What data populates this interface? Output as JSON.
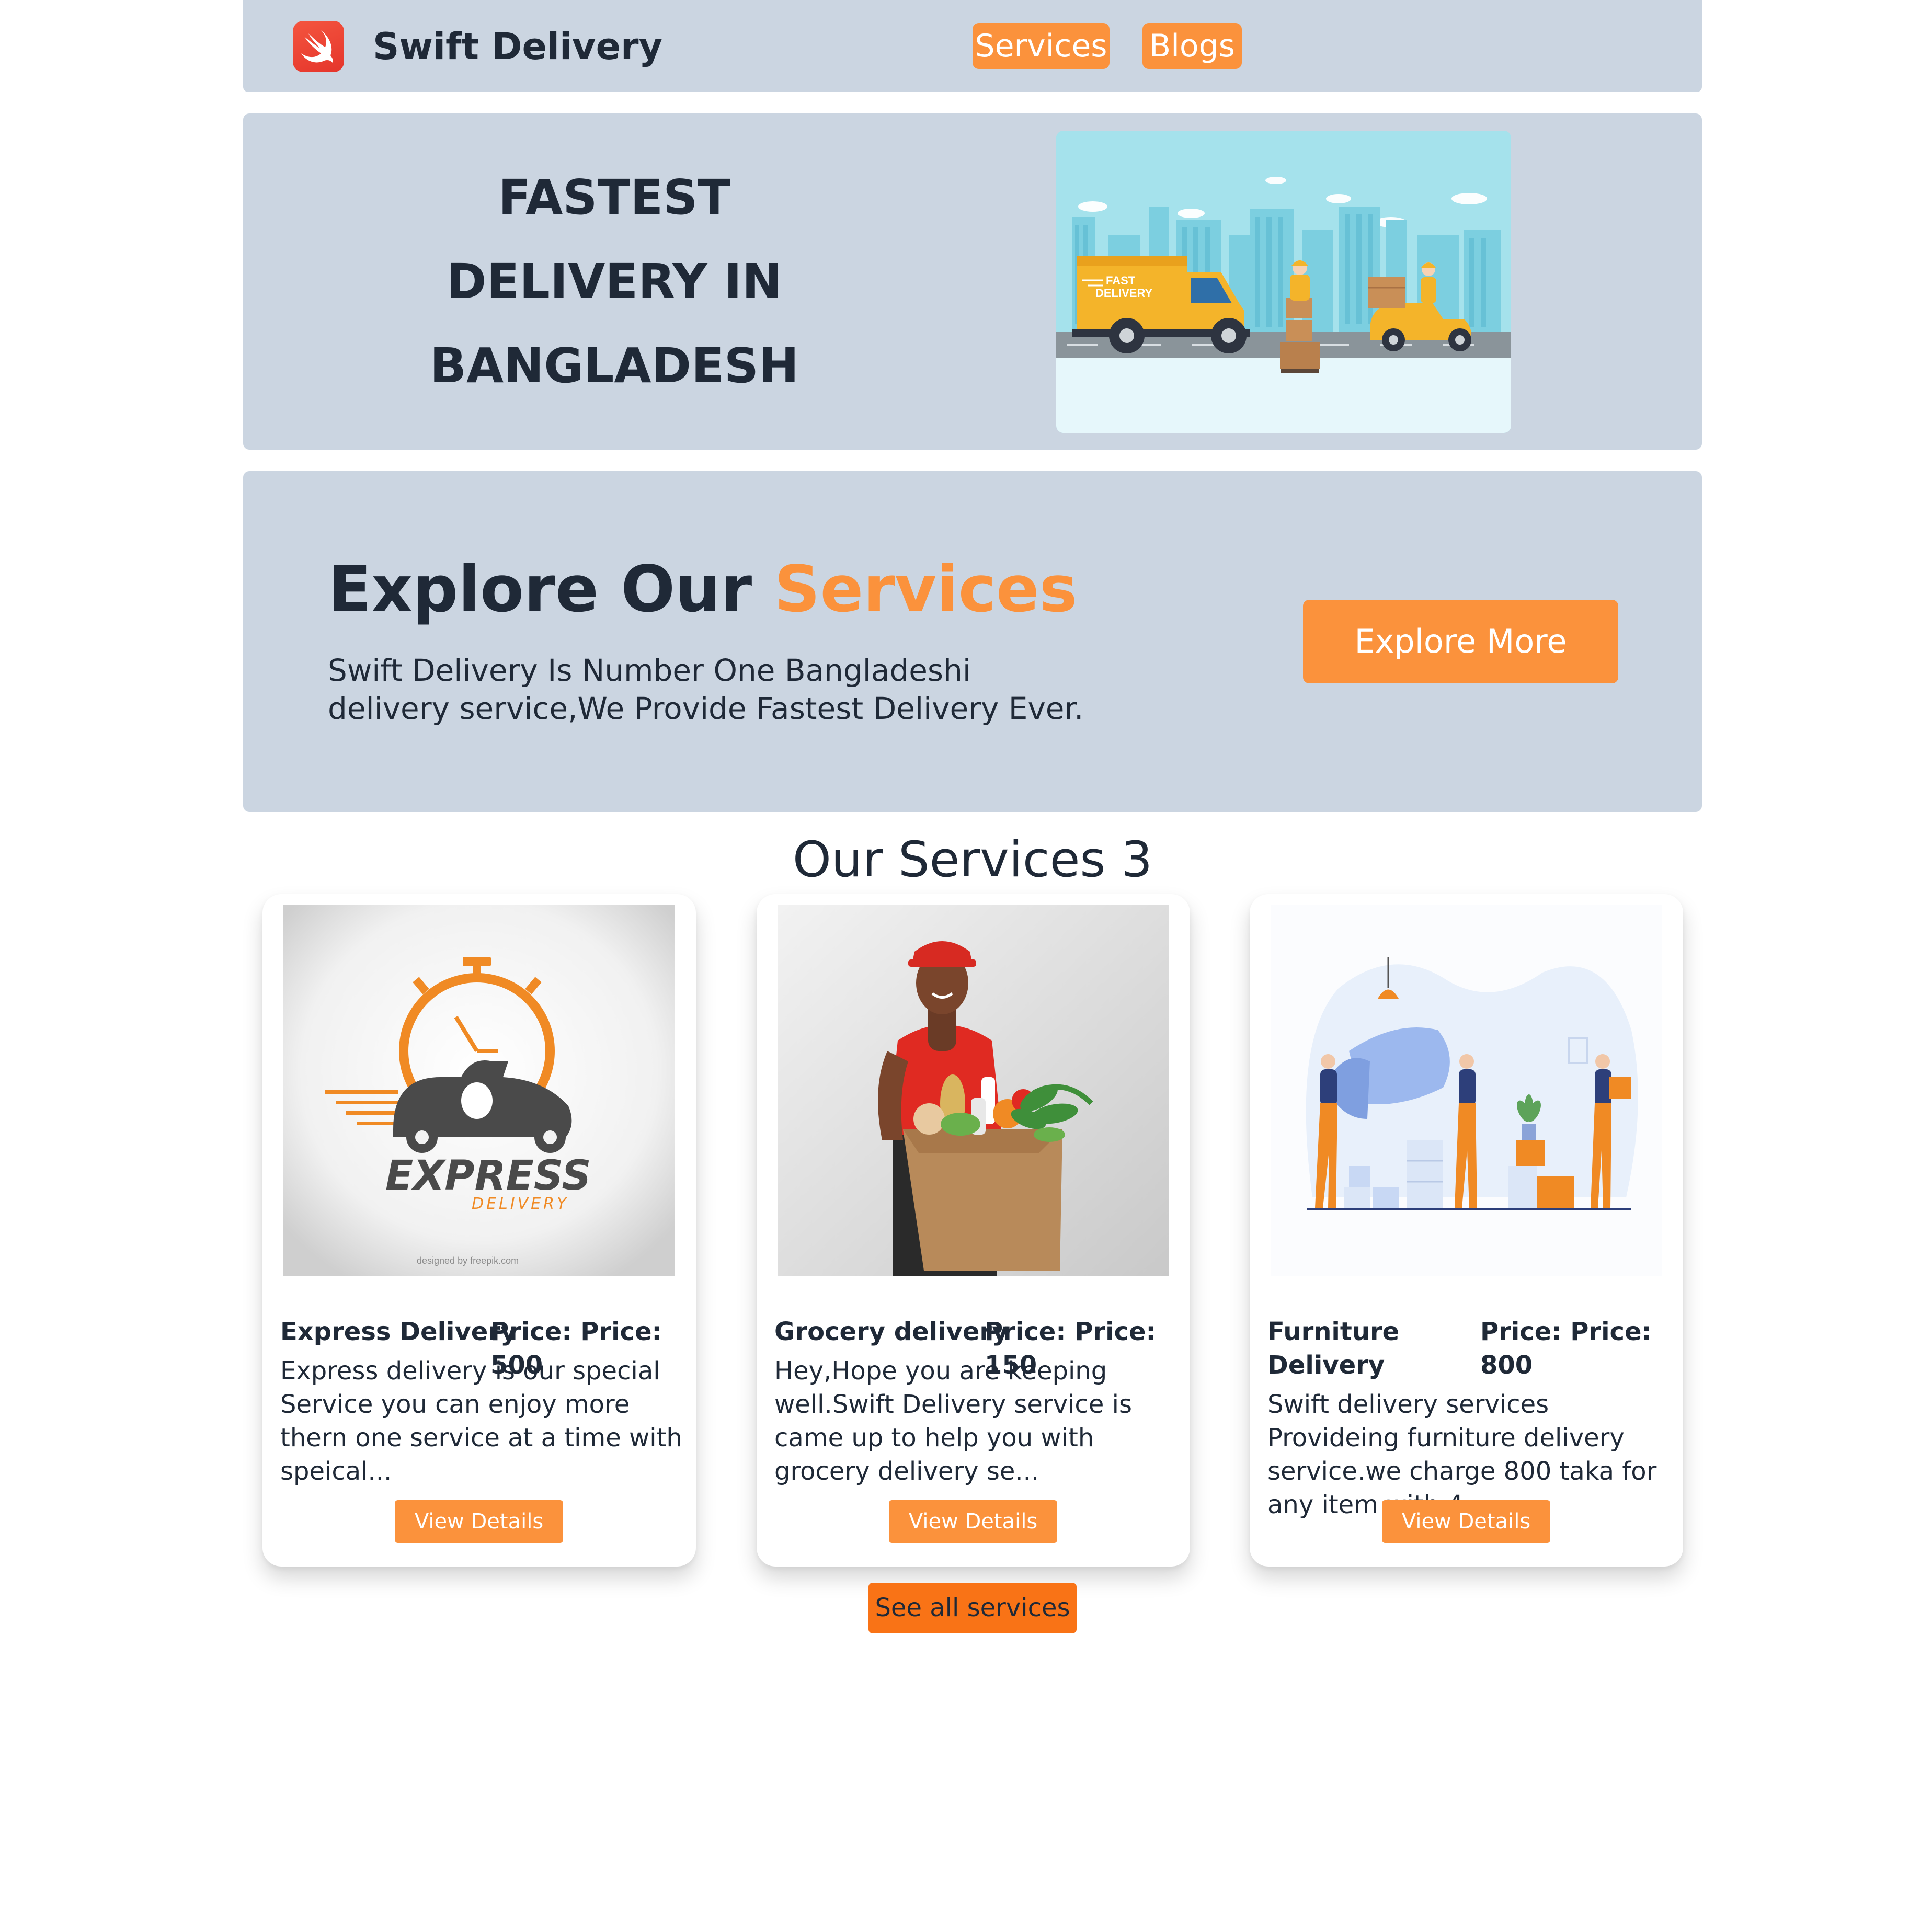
{
  "navbar": {
    "brand": "Swift Delivery",
    "links": [
      "Services",
      "Blogs"
    ]
  },
  "hero": {
    "lines": [
      "FASTEST",
      "DELIVERY IN",
      "BANGLADESH"
    ],
    "image_text": [
      "FAST",
      "DELIVERY"
    ]
  },
  "explore": {
    "title_main": "Explore Our ",
    "title_accent": "Services",
    "description": "Swift Delivery Is Number One Bangladeshi delivery service,We Provide Fastest Delivery Ever.",
    "button": "Explore More"
  },
  "services": {
    "heading": "Our Services 3",
    "items": [
      {
        "name": "Express Delivery",
        "price": "Price: Price: 500",
        "description": "Express delivery is our special Service you can enjoy more thern one service at a time with speical...",
        "button": "View Details",
        "image_text": [
          "EXPRESS",
          "DELIVERY",
          "designed by freepik.com"
        ]
      },
      {
        "name": "Grocery delivery",
        "price": "Price: Price: 150",
        "description": "Hey,Hope you are keeping well.Swift Delivery service is came up to help you with grocery delivery se...",
        "button": "View Details"
      },
      {
        "name": "Furniture Delivery",
        "price": "Price: Price: 800",
        "description": "Swift delivery services Provideing furniture delivery service.we charge 800 taka for any item with 4...",
        "button": "View Details"
      }
    ],
    "see_all": "See all services"
  },
  "colors": {
    "panel": "#cbd5e1",
    "accent": "#fb923c",
    "accent_dark": "#f97316",
    "text": "#1f2937"
  },
  "icons": [
    "swift-logo-icon"
  ]
}
